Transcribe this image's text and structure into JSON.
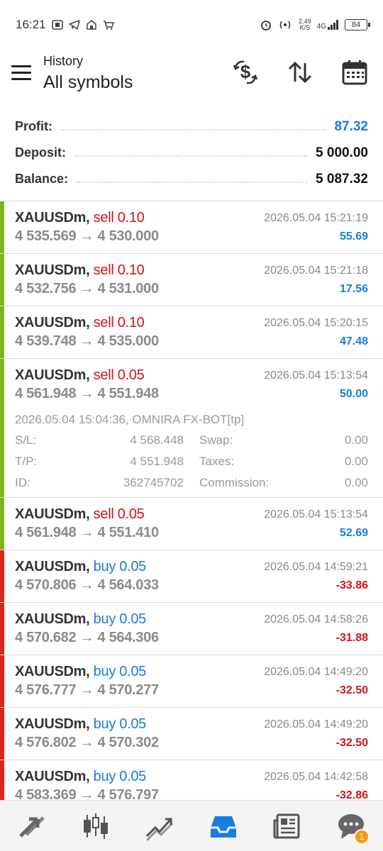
{
  "status_bar": {
    "time": "16:21",
    "net_speed": "2.49",
    "net_unit": "K/S",
    "net_type": "4G",
    "battery": "84"
  },
  "header": {
    "subtitle": "History",
    "title": "All symbols"
  },
  "summary": [
    {
      "label": "Profit:",
      "value": "87.32",
      "kind": "profit"
    },
    {
      "label": "Deposit:",
      "value": "5 000.00",
      "kind": "normal"
    },
    {
      "label": "Balance:",
      "value": "5 087.32",
      "kind": "normal"
    }
  ],
  "deals": [
    {
      "symbol": "XAUUSDm,",
      "side": "sell 0.10",
      "type": "sell",
      "time": "2026.05.04 15:21:19",
      "prices": "4 535.569 → 4 530.000",
      "profit": "55.69",
      "sign": "pos"
    },
    {
      "symbol": "XAUUSDm,",
      "side": "sell 0.10",
      "type": "sell",
      "time": "2026.05.04 15:21:18",
      "prices": "4 532.756 → 4 531.000",
      "profit": "17.56",
      "sign": "pos"
    },
    {
      "symbol": "XAUUSDm,",
      "side": "sell 0.10",
      "type": "sell",
      "time": "2026.05.04 15:20:15",
      "prices": "4 539.748 → 4 535.000",
      "profit": "47.48",
      "sign": "pos"
    },
    {
      "symbol": "XAUUSDm,",
      "side": "sell 0.05",
      "type": "sell",
      "time": "2026.05.04 15:13:54",
      "prices": "4 561.948 → 4 551.948",
      "profit": "50.00",
      "sign": "pos"
    },
    {
      "symbol": "XAUUSDm,",
      "side": "sell 0.05",
      "type": "sell",
      "time": "2026.05.04 15:13:54",
      "prices": "4 561.948 → 4 551.410",
      "profit": "52.69",
      "sign": "pos"
    },
    {
      "symbol": "XAUUSDm,",
      "side": "buy 0.05",
      "type": "buy",
      "time": "2026.05.04 14:59:21",
      "prices": "4 570.806 → 4 564.033",
      "profit": "-33.86",
      "sign": "neg"
    },
    {
      "symbol": "XAUUSDm,",
      "side": "buy 0.05",
      "type": "buy",
      "time": "2026.05.04 14:58:26",
      "prices": "4 570.682 → 4 564.306",
      "profit": "-31.88",
      "sign": "neg"
    },
    {
      "symbol": "XAUUSDm,",
      "side": "buy 0.05",
      "type": "buy",
      "time": "2026.05.04 14:49:20",
      "prices": "4 576.777 → 4 570.277",
      "profit": "-32.50",
      "sign": "neg"
    },
    {
      "symbol": "XAUUSDm,",
      "side": "buy 0.05",
      "type": "buy",
      "time": "2026.05.04 14:49:20",
      "prices": "4 576.802 → 4 570.302",
      "profit": "-32.50",
      "sign": "neg"
    },
    {
      "symbol": "XAUUSDm,",
      "side": "buy 0.05",
      "type": "buy",
      "time": "2026.05.04 14:42:58",
      "prices": "4 583.369 → 4 576.797",
      "profit": "-32.86",
      "sign": "neg"
    }
  ],
  "expanded_deal": {
    "comment": "2026.05.04 15:04:36, OMNIRA FX-BOT[tp]",
    "rows": [
      {
        "l1": "S/L:",
        "v1": "4 568.448",
        "l2": "Swap:",
        "v2": "0.00"
      },
      {
        "l1": "T/P:",
        "v1": "4 551.948",
        "l2": "Taxes:",
        "v2": "0.00"
      },
      {
        "l1": "ID:",
        "v1": "362745702",
        "l2": "Commission:",
        "v2": "0.00"
      }
    ]
  },
  "nav": {
    "chat_badge": "1"
  },
  "colors": {
    "accent": "#1a7de0",
    "sell": "#d0141c",
    "profit_bar": "#7ab51d",
    "loss_bar": "#e2231a"
  }
}
